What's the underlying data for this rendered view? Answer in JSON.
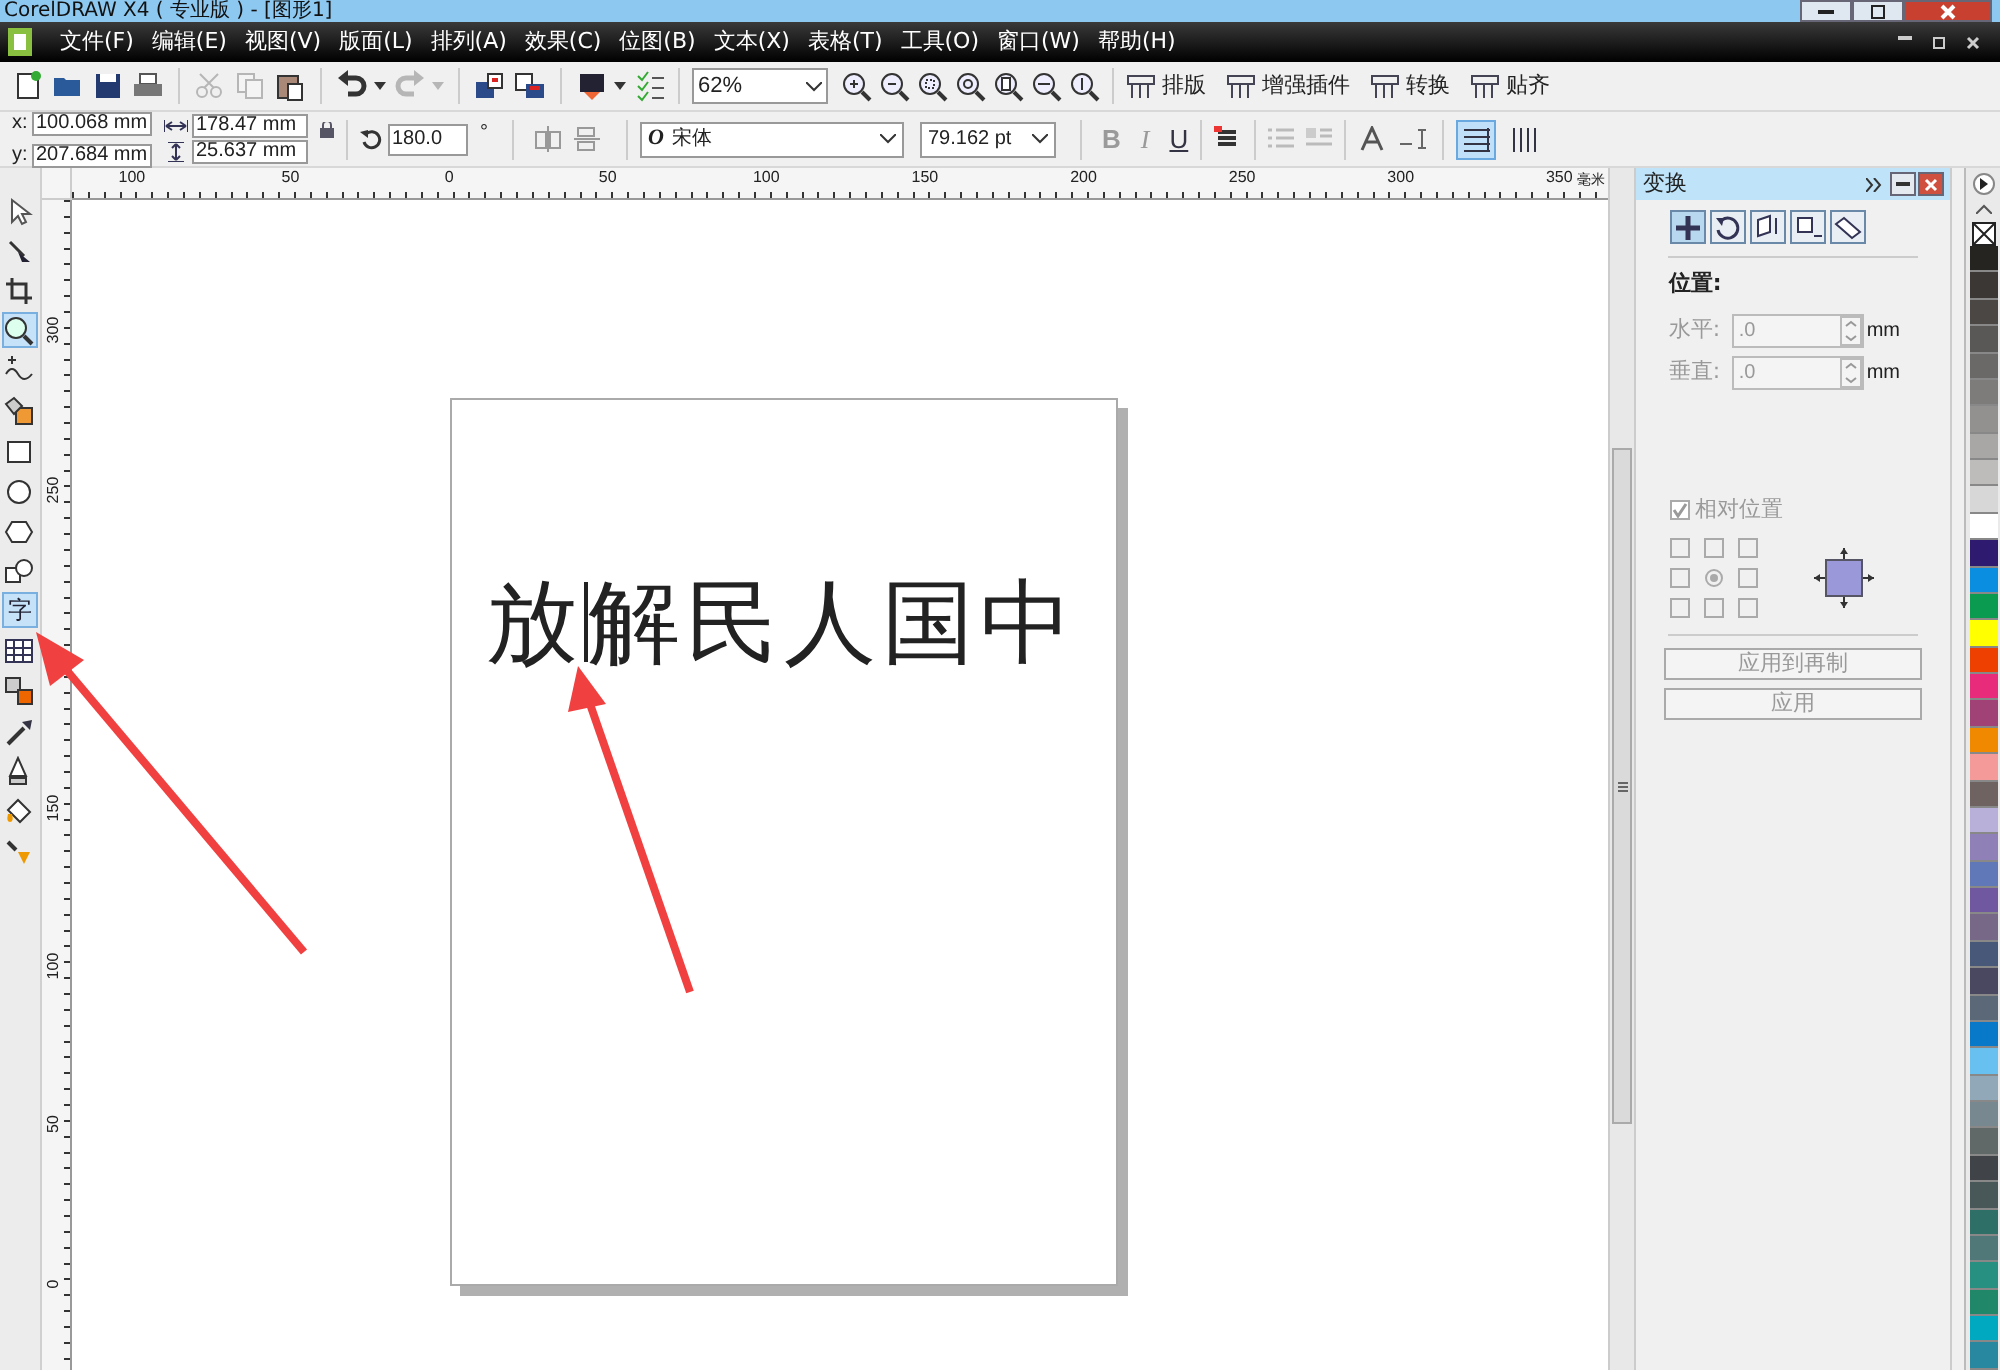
{
  "window": {
    "title": "CorelDRAW X4 ( 专业版 ) - [图形1]"
  },
  "menu": [
    "文件(F)",
    "编辑(E)",
    "视图(V)",
    "版面(L)",
    "排列(A)",
    "效果(C)",
    "位图(B)",
    "文本(X)",
    "表格(T)",
    "工具(O)",
    "窗口(W)",
    "帮助(H)"
  ],
  "toolbar": {
    "buttons": [
      {
        "kind": "new",
        "disabled": false
      },
      {
        "kind": "open",
        "disabled": false
      },
      {
        "kind": "save",
        "disabled": false
      },
      {
        "kind": "print",
        "disabled": false
      },
      {
        "kind": "sep"
      },
      {
        "kind": "cut",
        "disabled": true
      },
      {
        "kind": "copy",
        "disabled": true
      },
      {
        "kind": "paste",
        "disabled": false
      },
      {
        "kind": "sep"
      },
      {
        "kind": "undo",
        "disabled": false
      },
      {
        "kind": "redo",
        "disabled": true
      },
      {
        "kind": "sep"
      },
      {
        "kind": "import",
        "disabled": false
      },
      {
        "kind": "export",
        "disabled": false
      },
      {
        "kind": "sep"
      },
      {
        "kind": "launcher",
        "disabled": false
      },
      {
        "kind": "options",
        "disabled": false
      }
    ],
    "zoom": "62%",
    "zoom_buttons": [
      {
        "kind": "zoom-in"
      },
      {
        "kind": "zoom-out"
      },
      {
        "kind": "zoom-selected"
      },
      {
        "kind": "zoom-all"
      },
      {
        "kind": "zoom-page"
      },
      {
        "kind": "zoom-width"
      },
      {
        "kind": "zoom-height"
      }
    ],
    "menus": [
      "排版",
      "增强插件",
      "转换",
      "贴齐"
    ]
  },
  "property_bar": {
    "x": "100.068 mm",
    "y": "207.684 mm",
    "width": "178.47 mm",
    "height": "25.637 mm",
    "x_label": "x:",
    "y_label": "y:",
    "angle": "180.0",
    "degree": "°",
    "font": "宋体",
    "font_glyph": "O",
    "size": "79.162 pt",
    "styles": [
      {
        "glyph": "B",
        "disabled": true
      },
      {
        "glyph": "I",
        "disabled": true
      },
      {
        "glyph": "U",
        "disabled": false
      }
    ],
    "orientations": [
      {
        "kind": "horizontal",
        "selected": true
      },
      {
        "kind": "vertical",
        "selected": false
      }
    ]
  },
  "toolbox": [
    {
      "kind": "pick",
      "selected": false
    },
    {
      "kind": "shape",
      "selected": false
    },
    {
      "kind": "crop",
      "selected": false
    },
    {
      "kind": "zoom",
      "selected": true
    },
    {
      "kind": "freehand",
      "selected": false
    },
    {
      "kind": "smartfill",
      "selected": false
    },
    {
      "kind": "rectangle",
      "selected": false
    },
    {
      "kind": "ellipse",
      "selected": false
    },
    {
      "kind": "polygon",
      "selected": false
    },
    {
      "kind": "shapes",
      "selected": false
    },
    {
      "kind": "text",
      "glyph": "字",
      "selected": true
    },
    {
      "kind": "table",
      "selected": false
    },
    {
      "kind": "blend",
      "selected": false
    },
    {
      "kind": "eyedropper",
      "selected": false
    },
    {
      "kind": "pen",
      "selected": false
    },
    {
      "kind": "fill",
      "selected": false
    },
    {
      "kind": "interactive",
      "selected": false
    }
  ],
  "rulers": {
    "horizontal": [
      "100",
      "50",
      "0",
      "50",
      "100",
      "150",
      "200",
      "250",
      "300",
      "350"
    ],
    "unit": "毫米",
    "vertical": [
      "300",
      "250",
      "150",
      "100",
      "50",
      "0"
    ]
  },
  "canvas": {
    "text_before_cursor": "放",
    "text_after_cursor": "解民人国中"
  },
  "docker": {
    "title": "变换",
    "tabs": [
      {
        "kind": "position",
        "selected": true
      },
      {
        "kind": "rotate",
        "selected": false
      },
      {
        "kind": "scale",
        "selected": false
      },
      {
        "kind": "size",
        "selected": false
      },
      {
        "kind": "skew",
        "selected": false
      }
    ],
    "section": "位置:",
    "fields": [
      {
        "label": "水平:",
        "value": ".0",
        "unit": "mm"
      },
      {
        "label": "垂直:",
        "value": ".0",
        "unit": "mm"
      }
    ],
    "relative": {
      "label": "相对位置",
      "checked": true
    },
    "anchors": [
      false,
      false,
      false,
      false,
      true,
      false,
      false,
      false,
      false
    ],
    "buttons": [
      "应用到再制",
      "应用"
    ]
  },
  "palette": [
    {
      "color": "#262421"
    },
    {
      "color": "#3a3734"
    },
    {
      "color": "#4a4744"
    },
    {
      "color": "#5a5856"
    },
    {
      "color": "#6b6967"
    },
    {
      "color": "#7e7c7a"
    },
    {
      "color": "#939190"
    },
    {
      "color": "#a8a7a6"
    },
    {
      "color": "#bdbcbb"
    },
    {
      "color": "#d7d7d7"
    },
    {
      "color": "#ffffff"
    },
    {
      "color": "#2e1a6e"
    },
    {
      "color": "#0a8fe0"
    },
    {
      "color": "#0a9a50"
    },
    {
      "color": "#ffff00"
    },
    {
      "color": "#ee4000"
    },
    {
      "color": "#e82b7a"
    },
    {
      "color": "#a04276"
    },
    {
      "color": "#f08800"
    },
    {
      "color": "#f49a98"
    },
    {
      "color": "#6e6360"
    },
    {
      "color": "#b8b0d8"
    },
    {
      "color": "#9080b8"
    },
    {
      "color": "#6078b8"
    },
    {
      "color": "#7058a0"
    },
    {
      "color": "#786888"
    },
    {
      "color": "#485878"
    },
    {
      "color": "#4a4860"
    },
    {
      "color": "#5a6878"
    },
    {
      "color": "#0878c8"
    },
    {
      "color": "#68c0f0"
    },
    {
      "color": "#90a8b8"
    },
    {
      "color": "#788890"
    },
    {
      "color": "#606868"
    },
    {
      "color": "#404448"
    },
    {
      "color": "#485858"
    },
    {
      "color": "#2e7068"
    },
    {
      "color": "#507878"
    },
    {
      "color": "#289080"
    },
    {
      "color": "#208868"
    },
    {
      "color": "#00a8c0"
    },
    {
      "color": "#2888a0"
    }
  ]
}
